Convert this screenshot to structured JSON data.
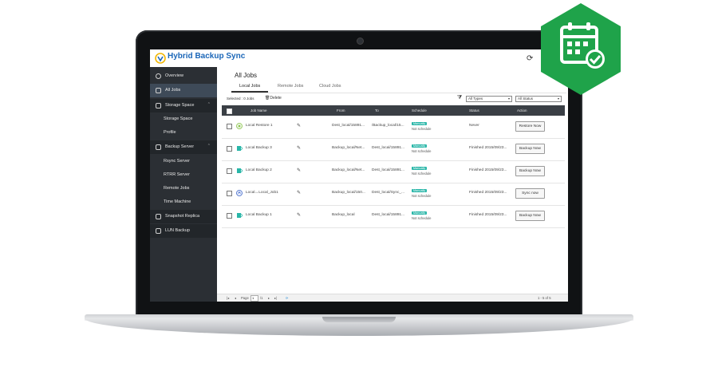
{
  "app": {
    "title": "Hybrid Backup Sync"
  },
  "sidebar": {
    "items": [
      {
        "label": "Overview"
      },
      {
        "label": "All Jobs"
      },
      {
        "label": "Storage Space"
      },
      {
        "label": "Storage Space"
      },
      {
        "label": "Profile"
      },
      {
        "label": "Backup Server"
      },
      {
        "label": "Rsync Server"
      },
      {
        "label": "RTRR Server"
      },
      {
        "label": "Remote Jobs"
      },
      {
        "label": "Time Machine"
      },
      {
        "label": "Snapshot Replica"
      },
      {
        "label": "LUN Backup"
      }
    ]
  },
  "main": {
    "title": "All Jobs",
    "tabs": [
      {
        "label": "Local Jobs"
      },
      {
        "label": "Remote Jobs"
      },
      {
        "label": "Cloud Jobs"
      }
    ],
    "toolbar": {
      "selected": "Selected : 0 Jobs",
      "delete_label": "Delete"
    },
    "filters": {
      "type": "All Types",
      "status": "All Status"
    },
    "table": {
      "columns": [
        "Job Name",
        "From",
        "To",
        "Schedule",
        "Status",
        "Action"
      ],
      "rows": [
        {
          "name": "Local Restore 1",
          "from": "Dest_local/15891...",
          "to": "/Backup_local/15...",
          "schedule_badge": "Manually",
          "schedule_sub": "Not schedule",
          "status": "Never",
          "action": "Restore Now"
        },
        {
          "name": "Local Backup 3",
          "from": "Backup_local/Net...",
          "to": "Dest_local/15891...",
          "schedule_badge": "Manually",
          "schedule_sub": "Not schedule",
          "status": "Finished 2015/09/23...",
          "action": "Backup Now"
        },
        {
          "name": "Local Backup 2",
          "from": "Backup_local/Net...",
          "to": "Dest_local/15891...",
          "schedule_badge": "Manually",
          "schedule_sub": "Not schedule",
          "status": "Finished 2015/09/23...",
          "action": "Backup Now"
        },
        {
          "name": "Local↔Local_Job1",
          "from": "Backup_local/150...",
          "to": "Dest_local/Sync_...",
          "schedule_badge": "Manually",
          "schedule_sub": "Not schedule",
          "status": "Finished 2015/09/23...",
          "action": "Sync now"
        },
        {
          "name": "Local Backup 1",
          "from": "Backup_local",
          "to": "Dest_local/15891...",
          "schedule_badge": "Manually",
          "schedule_sub": "Not schedule",
          "status": "Finished 2015/09/23...",
          "action": "Backup Now"
        }
      ]
    },
    "pagination": {
      "page_label": "Page",
      "page_value": "1",
      "of": "/1",
      "range": "1 - 5 of 5"
    }
  },
  "colors": {
    "accent": "#2a8fd8",
    "badge_green": "#1fa34a",
    "schedule_teal": "#29b6a8",
    "sidebar_bg": "#2b2f34"
  },
  "icons": {
    "refresh": "refresh-icon",
    "filter": "filter-icon",
    "calendar_badge": "calendar-check-icon"
  }
}
